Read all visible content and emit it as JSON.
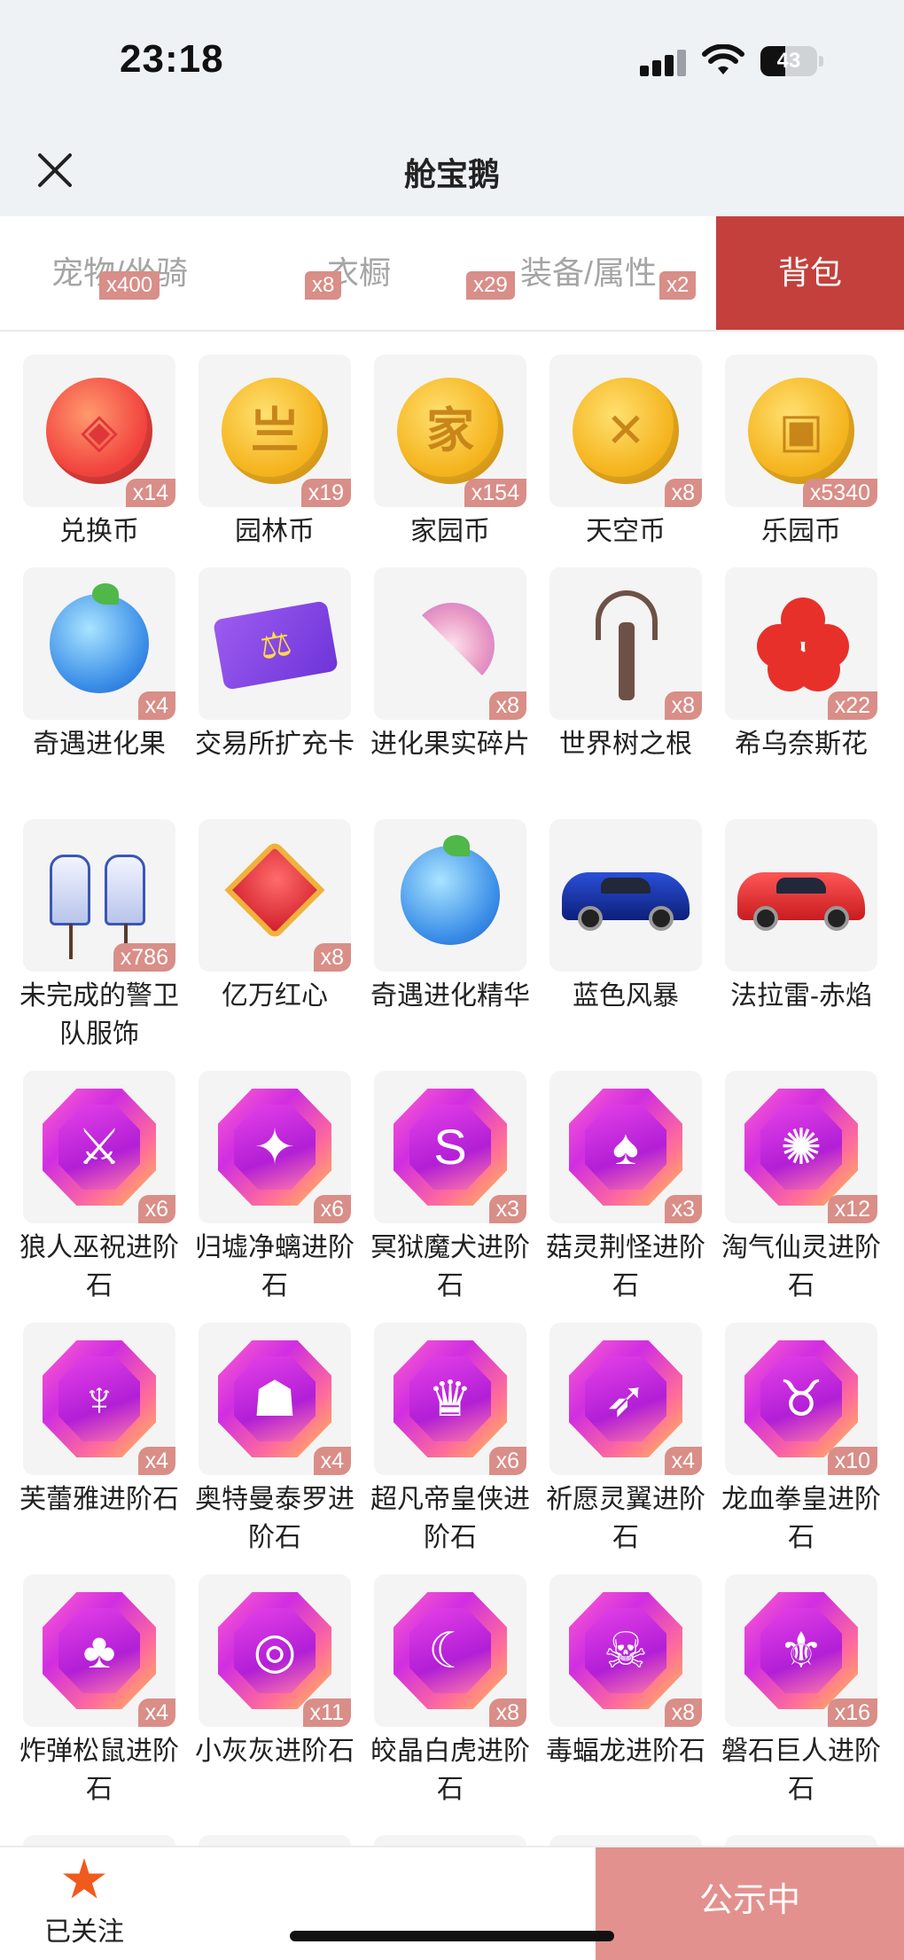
{
  "status_bar": {
    "time": "23:18",
    "battery": "43",
    "battery_level": 0.43
  },
  "header": {
    "title": "舱宝鹅"
  },
  "tabs": [
    {
      "label": "宠物/坐骑",
      "count": "x400"
    },
    {
      "label": "衣橱",
      "count": "x8"
    },
    {
      "label": "装备/属性",
      "count": "x29"
    },
    {
      "label": "背包",
      "count": "x2",
      "active": true
    }
  ],
  "items": [
    {
      "name": "兑换币",
      "qty": "x14",
      "icon": "gem-coin-icon"
    },
    {
      "name": "园林币",
      "qty": "x19",
      "icon": "garden-coin-icon"
    },
    {
      "name": "家园币",
      "qty": "x154",
      "icon": "home-coin-icon"
    },
    {
      "name": "天空币",
      "qty": "x8",
      "icon": "sky-coin-icon"
    },
    {
      "name": "乐园币",
      "qty": "x5340",
      "icon": "paradise-coin-icon"
    },
    {
      "name": "奇遇进化果",
      "qty": "x4",
      "icon": "evolution-fruit-icon"
    },
    {
      "name": "交易所扩充卡",
      "qty": "",
      "icon": "exchange-card-icon"
    },
    {
      "name": "进化果实碎片",
      "qty": "x8",
      "icon": "fruit-fragment-icon"
    },
    {
      "name": "世界树之根",
      "qty": "x8",
      "icon": "world-tree-root-icon"
    },
    {
      "name": "希乌奈斯花",
      "qty": "x22",
      "icon": "red-flower-icon"
    },
    {
      "name": "未完成的警卫队服饰",
      "qty": "x786",
      "icon": "guard-outfit-icon"
    },
    {
      "name": "亿万红心",
      "qty": "x8",
      "icon": "red-heart-icon"
    },
    {
      "name": "奇遇进化精华",
      "qty": "",
      "icon": "evolution-essence-icon"
    },
    {
      "name": "蓝色风暴",
      "qty": "",
      "icon": "blue-car-icon"
    },
    {
      "name": "法拉雷-赤焰",
      "qty": "",
      "icon": "red-car-icon"
    },
    {
      "name": "狼人巫祝进阶石",
      "qty": "x6",
      "icon": "advancement-stone-icon"
    },
    {
      "name": "归墟净螭进阶石",
      "qty": "x6",
      "icon": "advancement-stone-icon"
    },
    {
      "name": "冥狱魔犬进阶石",
      "qty": "x3",
      "icon": "advancement-stone-icon"
    },
    {
      "name": "菇灵荆怪进阶石",
      "qty": "x3",
      "icon": "advancement-stone-icon"
    },
    {
      "name": "淘气仙灵进阶石",
      "qty": "x12",
      "icon": "advancement-stone-icon"
    },
    {
      "name": "芙蕾雅进阶石",
      "qty": "x4",
      "icon": "advancement-stone-icon"
    },
    {
      "name": "奥特曼泰罗进阶石",
      "qty": "x4",
      "icon": "advancement-stone-icon"
    },
    {
      "name": "超凡帝皇侠进阶石",
      "qty": "x6",
      "icon": "advancement-stone-icon"
    },
    {
      "name": "祈愿灵翼进阶石",
      "qty": "x4",
      "icon": "advancement-stone-icon"
    },
    {
      "name": "龙血拳皇进阶石",
      "qty": "x10",
      "icon": "advancement-stone-icon"
    },
    {
      "name": "炸弹松鼠进阶石",
      "qty": "x4",
      "icon": "advancement-stone-icon"
    },
    {
      "name": "小灰灰进阶石",
      "qty": "x11",
      "icon": "advancement-stone-icon"
    },
    {
      "name": "皎晶白虎进阶石",
      "qty": "x8",
      "icon": "advancement-stone-icon"
    },
    {
      "name": "毒蝠龙进阶石",
      "qty": "x8",
      "icon": "advancement-stone-icon"
    },
    {
      "name": "磐石巨人进阶石",
      "qty": "x16",
      "icon": "advancement-stone-icon"
    }
  ],
  "bottom_bar": {
    "follow_label": "已关注",
    "public_label": "公示中"
  },
  "colors": {
    "accent": "#c4403c",
    "badge": "#d98e88",
    "public_button": "#e3918e",
    "star": "#f05a1c"
  }
}
